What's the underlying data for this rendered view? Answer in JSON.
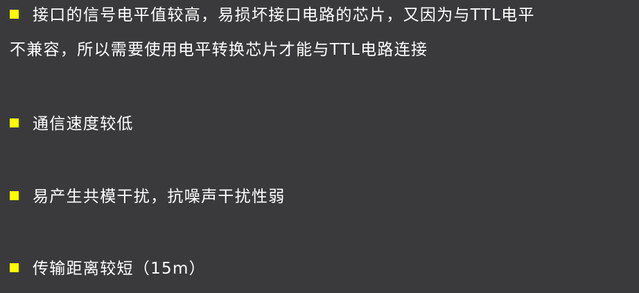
{
  "bullets": [
    {
      "line1": "接口的信号电平值较高，易损坏接口电路的芯片，又因为与TTL电平",
      "line2": "不兼容，所以需要使用电平转换芯片才能与TTL电路连接"
    },
    {
      "line1": "通信速度较低"
    },
    {
      "line1": "易产生共模干扰，抗噪声干扰性弱"
    },
    {
      "line1": "传输距离较短（15m）"
    }
  ],
  "colors": {
    "background": "#3a3a3d",
    "bullet_marker": "#ffff00",
    "text": "#ffffff"
  }
}
